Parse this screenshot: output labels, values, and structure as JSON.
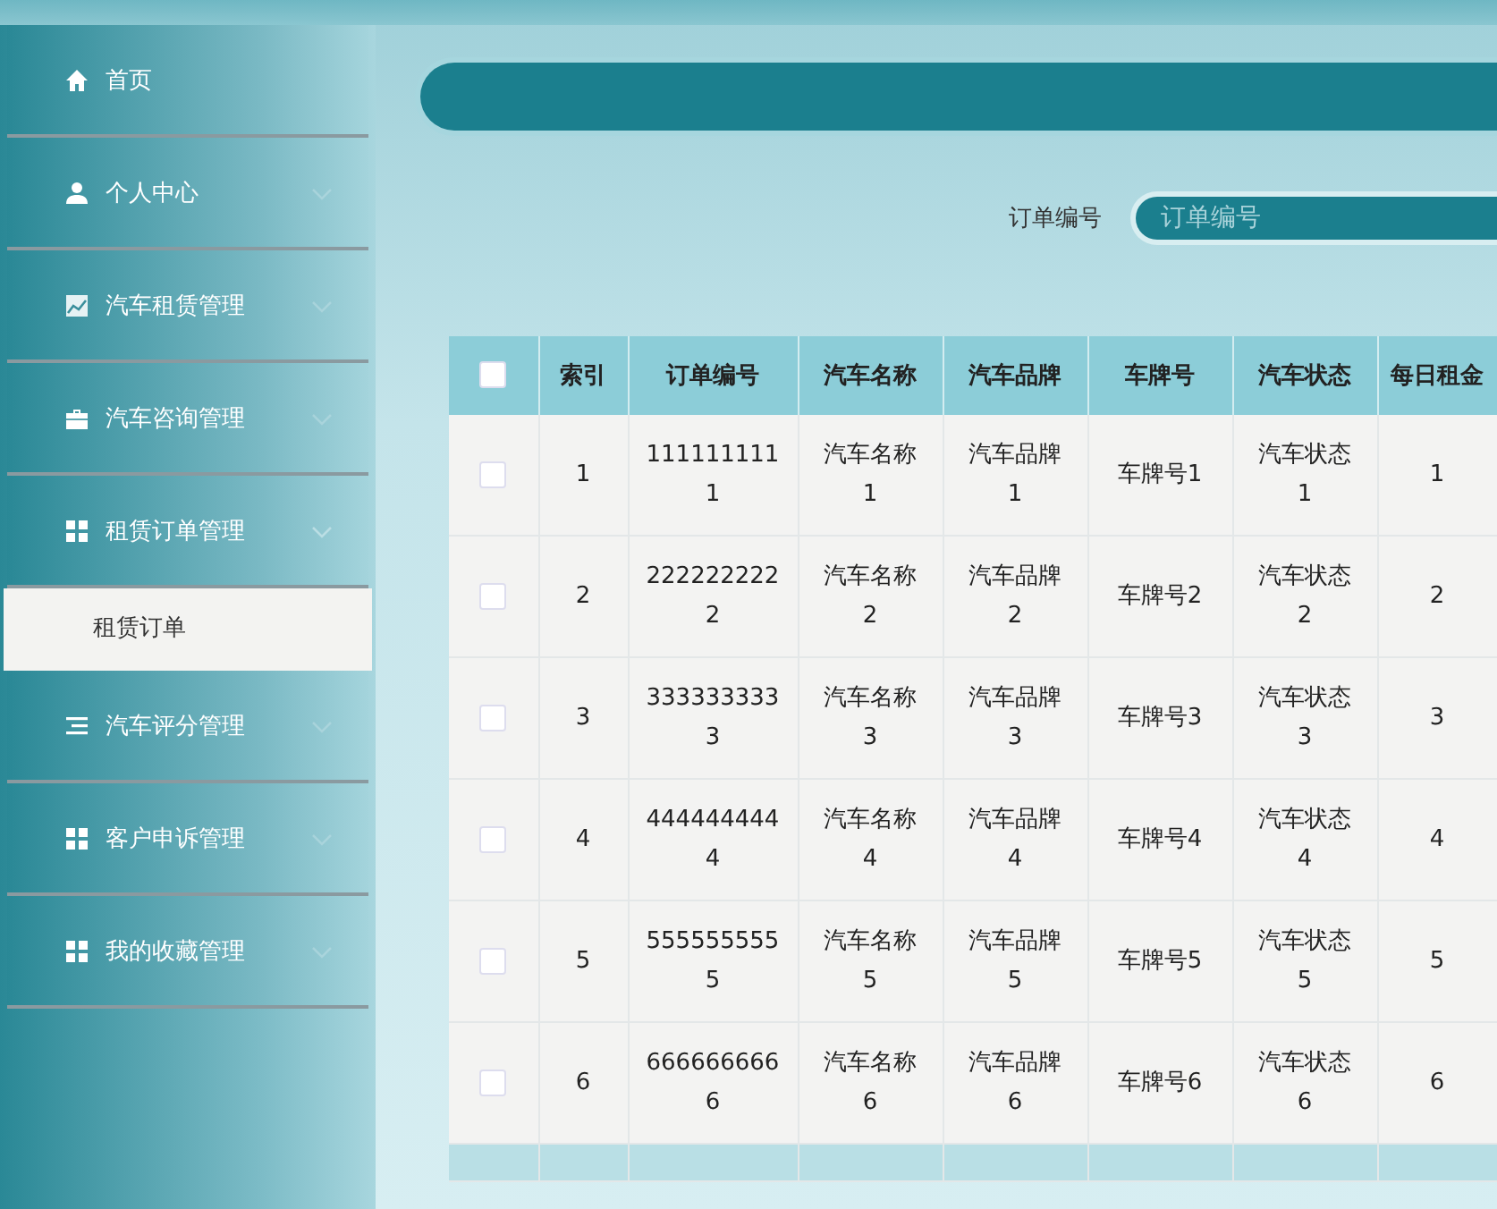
{
  "sidebar": {
    "items": [
      {
        "label": "首页",
        "has_children": false
      },
      {
        "label": "个人中心",
        "has_children": true,
        "expanded": false
      },
      {
        "label": "汽车租赁管理",
        "has_children": true,
        "expanded": false
      },
      {
        "label": "汽车咨询管理",
        "has_children": true,
        "expanded": false
      },
      {
        "label": "租赁订单管理",
        "has_children": true,
        "expanded": true,
        "children": [
          {
            "label": "租赁订单",
            "selected": true
          }
        ]
      },
      {
        "label": "汽车评分管理",
        "has_children": true,
        "expanded": false
      },
      {
        "label": "客户申诉管理",
        "has_children": true,
        "expanded": false
      },
      {
        "label": "我的收藏管理",
        "has_children": true,
        "expanded": false
      }
    ]
  },
  "search": {
    "label": "订单编号",
    "placeholder": "订单编号"
  },
  "table": {
    "header_checked": false,
    "columns": [
      "索引",
      "订单编号",
      "汽车名称",
      "汽车品牌",
      "车牌号",
      "汽车状态",
      "每日租金"
    ],
    "rows": [
      {
        "checked": false,
        "cells": [
          "1",
          "1111111111",
          "汽车名称1",
          "汽车品牌1",
          "车牌号1",
          "汽车状态1",
          "1"
        ]
      },
      {
        "checked": false,
        "cells": [
          "2",
          "2222222222",
          "汽车名称2",
          "汽车品牌2",
          "车牌号2",
          "汽车状态2",
          "2"
        ]
      },
      {
        "checked": false,
        "cells": [
          "3",
          "3333333333",
          "汽车名称3",
          "汽车品牌3",
          "车牌号3",
          "汽车状态3",
          "3"
        ]
      },
      {
        "checked": false,
        "cells": [
          "4",
          "4444444444",
          "汽车名称4",
          "汽车品牌4",
          "车牌号4",
          "汽车状态4",
          "4"
        ]
      },
      {
        "checked": false,
        "cells": [
          "5",
          "5555555555",
          "汽车名称5",
          "汽车品牌5",
          "车牌号5",
          "汽车状态5",
          "5"
        ]
      },
      {
        "checked": false,
        "cells": [
          "6",
          "6666666666",
          "汽车名称6",
          "汽车品牌6",
          "车牌号6",
          "汽车状态6",
          "6"
        ]
      }
    ]
  }
}
